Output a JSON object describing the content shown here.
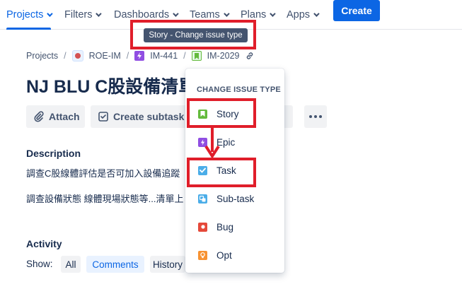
{
  "nav": {
    "items": [
      {
        "label": "Projects",
        "active": true
      },
      {
        "label": "Filters"
      },
      {
        "label": "Dashboards"
      },
      {
        "label": "Teams"
      },
      {
        "label": "Plans"
      },
      {
        "label": "Apps"
      }
    ],
    "create_label": "Create"
  },
  "tooltip": "Story - Change issue type",
  "breadcrumb": {
    "projects": "Projects",
    "project": "ROE-IM",
    "epic": "IM-441",
    "issue": "IM-2029"
  },
  "issue": {
    "title": "NJ BLU C股設備清單評估"
  },
  "actions": {
    "attach": "Attach",
    "create_subtask": "Create subtask"
  },
  "description": {
    "heading": "Description",
    "lines": [
      "調查C股線體評估是否可加入設備追蹤",
      "調查設備狀態 線體現場狀態等...清單上"
    ]
  },
  "activity": {
    "heading": "Activity",
    "show_label": "Show:",
    "filters": [
      {
        "label": "All"
      },
      {
        "label": "Comments",
        "selected": true
      },
      {
        "label": "History"
      }
    ]
  },
  "issue_type_menu": {
    "header": "CHANGE ISSUE TYPE",
    "items": [
      {
        "label": "Story",
        "icon": "story-icon",
        "color": "#63ba3c"
      },
      {
        "label": "Epic",
        "icon": "epic-icon",
        "color": "#904ee2"
      },
      {
        "label": "Task",
        "icon": "task-icon",
        "color": "#4bade8"
      },
      {
        "label": "Sub-task",
        "icon": "subtask-icon",
        "color": "#4bade8"
      },
      {
        "label": "Bug",
        "icon": "bug-icon",
        "color": "#e5493a"
      },
      {
        "label": "Opt",
        "icon": "lightbulb-icon",
        "color": "#f79232"
      }
    ]
  },
  "colors": {
    "accent": "#0c66e4",
    "annotation": "#e01e2a"
  }
}
